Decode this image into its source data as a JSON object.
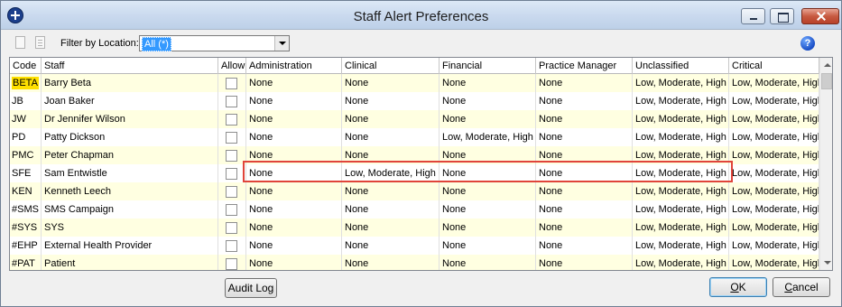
{
  "window": {
    "title": "Staff Alert Preferences"
  },
  "toolbar": {
    "filter_label": "Filter by Location:",
    "filter_value": "All (*)",
    "help_glyph": "?"
  },
  "grid": {
    "columns": [
      "Code",
      "Staff",
      "Allow",
      "Administration",
      "Clinical",
      "Financial",
      "Practice Manager",
      "Unclassified",
      "Critical"
    ],
    "rows": [
      {
        "code": "BETA",
        "staff": "Barry Beta",
        "allow": false,
        "administration": "None",
        "clinical": "None",
        "financial": "None",
        "practice_manager": "None",
        "unclassified": "Low, Moderate, High",
        "critical": "Low, Moderate, High"
      },
      {
        "code": "JB",
        "staff": "Joan Baker",
        "allow": false,
        "administration": "None",
        "clinical": "None",
        "financial": "None",
        "practice_manager": "None",
        "unclassified": "Low, Moderate, High",
        "critical": "Low, Moderate, High"
      },
      {
        "code": "JW",
        "staff": "Dr Jennifer Wilson",
        "allow": false,
        "administration": "None",
        "clinical": "None",
        "financial": "None",
        "practice_manager": "None",
        "unclassified": "Low, Moderate, High",
        "critical": "Low, Moderate, High"
      },
      {
        "code": "PD",
        "staff": "Patty Dickson",
        "allow": false,
        "administration": "None",
        "clinical": "None",
        "financial": "Low, Moderate, High",
        "practice_manager": "None",
        "unclassified": "Low, Moderate, High",
        "critical": "Low, Moderate, High"
      },
      {
        "code": "PMC",
        "staff": "Peter Chapman",
        "allow": false,
        "administration": "None",
        "clinical": "None",
        "financial": "None",
        "practice_manager": "None",
        "unclassified": "Low, Moderate, High",
        "critical": "Low, Moderate, High"
      },
      {
        "code": "SFE",
        "staff": "Sam Entwistle",
        "allow": false,
        "administration": "None",
        "clinical": "Low, Moderate, High",
        "financial": "None",
        "practice_manager": "None",
        "unclassified": "Low, Moderate, High",
        "critical": "Low, Moderate, High"
      },
      {
        "code": "KEN",
        "staff": "Kenneth Leech",
        "allow": false,
        "administration": "None",
        "clinical": "None",
        "financial": "None",
        "practice_manager": "None",
        "unclassified": "Low, Moderate, High",
        "critical": "Low, Moderate, High"
      },
      {
        "code": "#SMS",
        "staff": "SMS Campaign",
        "allow": false,
        "administration": "None",
        "clinical": "None",
        "financial": "None",
        "practice_manager": "None",
        "unclassified": "Low, Moderate, High",
        "critical": "Low, Moderate, High"
      },
      {
        "code": "#SYS",
        "staff": "SYS",
        "allow": false,
        "administration": "None",
        "clinical": "None",
        "financial": "None",
        "practice_manager": "None",
        "unclassified": "Low, Moderate, High",
        "critical": "Low, Moderate, High"
      },
      {
        "code": "#EHP",
        "staff": "External Health Provider",
        "allow": false,
        "administration": "None",
        "clinical": "None",
        "financial": "None",
        "practice_manager": "None",
        "unclassified": "Low, Moderate, High",
        "critical": "Low, Moderate, High"
      },
      {
        "code": "#PAT",
        "staff": "Patient",
        "allow": false,
        "administration": "None",
        "clinical": "None",
        "financial": "None",
        "practice_manager": "None",
        "unclassified": "Low, Moderate, High",
        "critical": "Low, Moderate, High"
      }
    ]
  },
  "buttons": {
    "audit_log": "Audit Log",
    "ok_mnemonic": "O",
    "ok_rest": "K",
    "cancel_mnemonic": "C",
    "cancel_rest": "ancel"
  },
  "colors": {
    "alt_row": "#ffffe1",
    "code_highlight": "#ffe000",
    "selection_outline": "#e0443a"
  },
  "icons": {
    "app": "app-plus-icon",
    "new": "new-document-icon",
    "open": "open-document-icon",
    "help": "help-icon",
    "dropdown": "chevron-down-icon"
  }
}
